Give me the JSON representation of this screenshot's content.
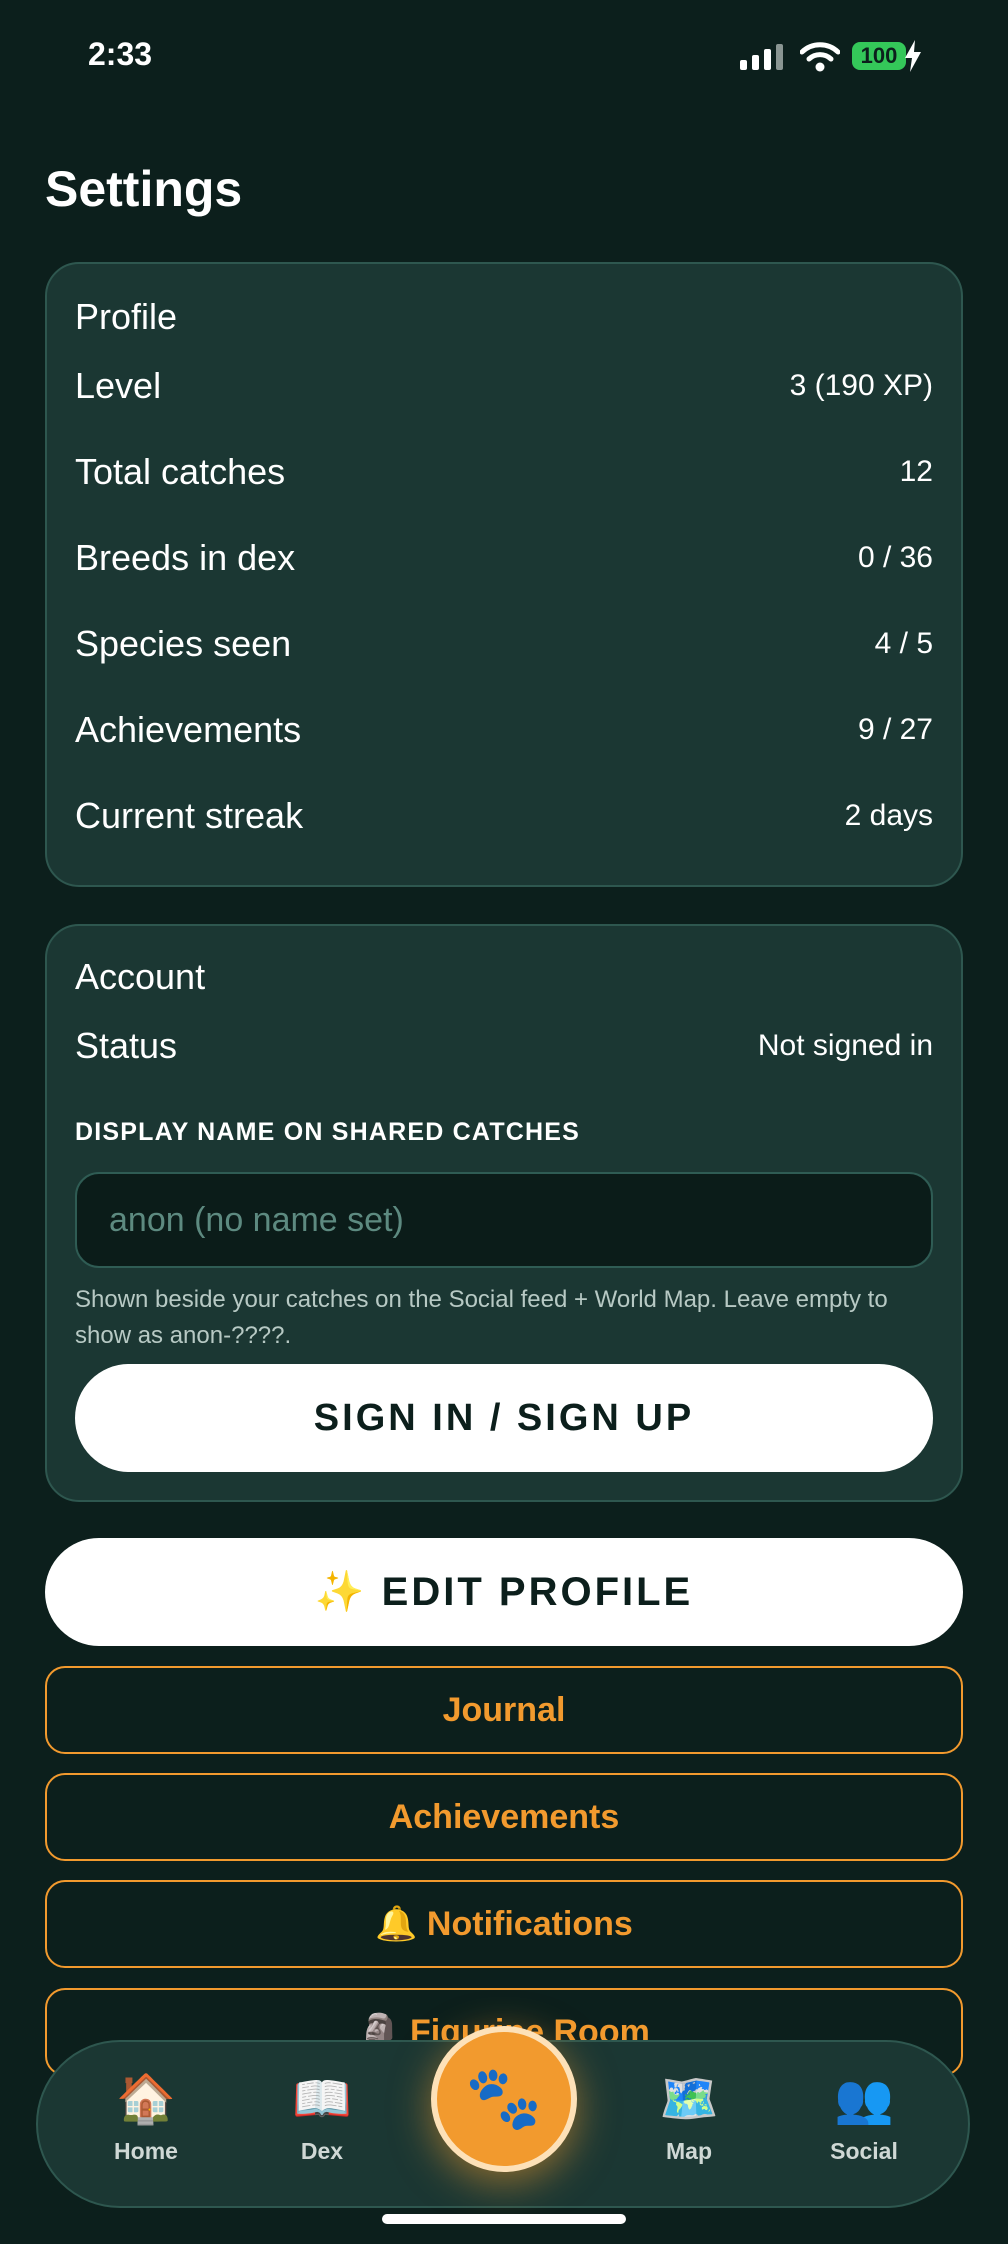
{
  "status_bar": {
    "time": "2:33",
    "battery": "100"
  },
  "page_title": "Settings",
  "profile": {
    "title": "Profile",
    "rows": [
      {
        "label": "Level",
        "value": "3 (190 XP)"
      },
      {
        "label": "Total catches",
        "value": "12"
      },
      {
        "label": "Breeds in dex",
        "value": "0 / 36"
      },
      {
        "label": "Species seen",
        "value": "4 / 5"
      },
      {
        "label": "Achievements",
        "value": "9 / 27"
      },
      {
        "label": "Current streak",
        "value": "2 days"
      }
    ]
  },
  "account": {
    "title": "Account",
    "status_label": "Status",
    "status_value": "Not signed in",
    "display_name_label": "DISPLAY NAME ON SHARED CATCHES",
    "display_name_value": "",
    "display_name_placeholder": "anon (no name set)",
    "helper_text": "Shown beside your catches on the Social feed + World Map. Leave empty to show as anon-????.",
    "sign_in_label": "SIGN IN / SIGN UP"
  },
  "buttons": {
    "edit_profile": "✨ EDIT PROFILE",
    "journal": "Journal",
    "achievements": "Achievements",
    "notifications": "🔔 Notifications",
    "figurine_room": "🗿 Figurine Room"
  },
  "tab_bar": {
    "home": {
      "icon": "🏠",
      "label": "Home"
    },
    "dex": {
      "icon": "📖",
      "label": "Dex"
    },
    "catch": {
      "icon": "🐾"
    },
    "map": {
      "icon": "🗺️",
      "label": "Map"
    },
    "social": {
      "icon": "👥",
      "label": "Social"
    }
  },
  "colors": {
    "background": "#0c1f1c",
    "card": "#1b3733",
    "accent": "#f29a2e",
    "battery": "#34c759"
  }
}
